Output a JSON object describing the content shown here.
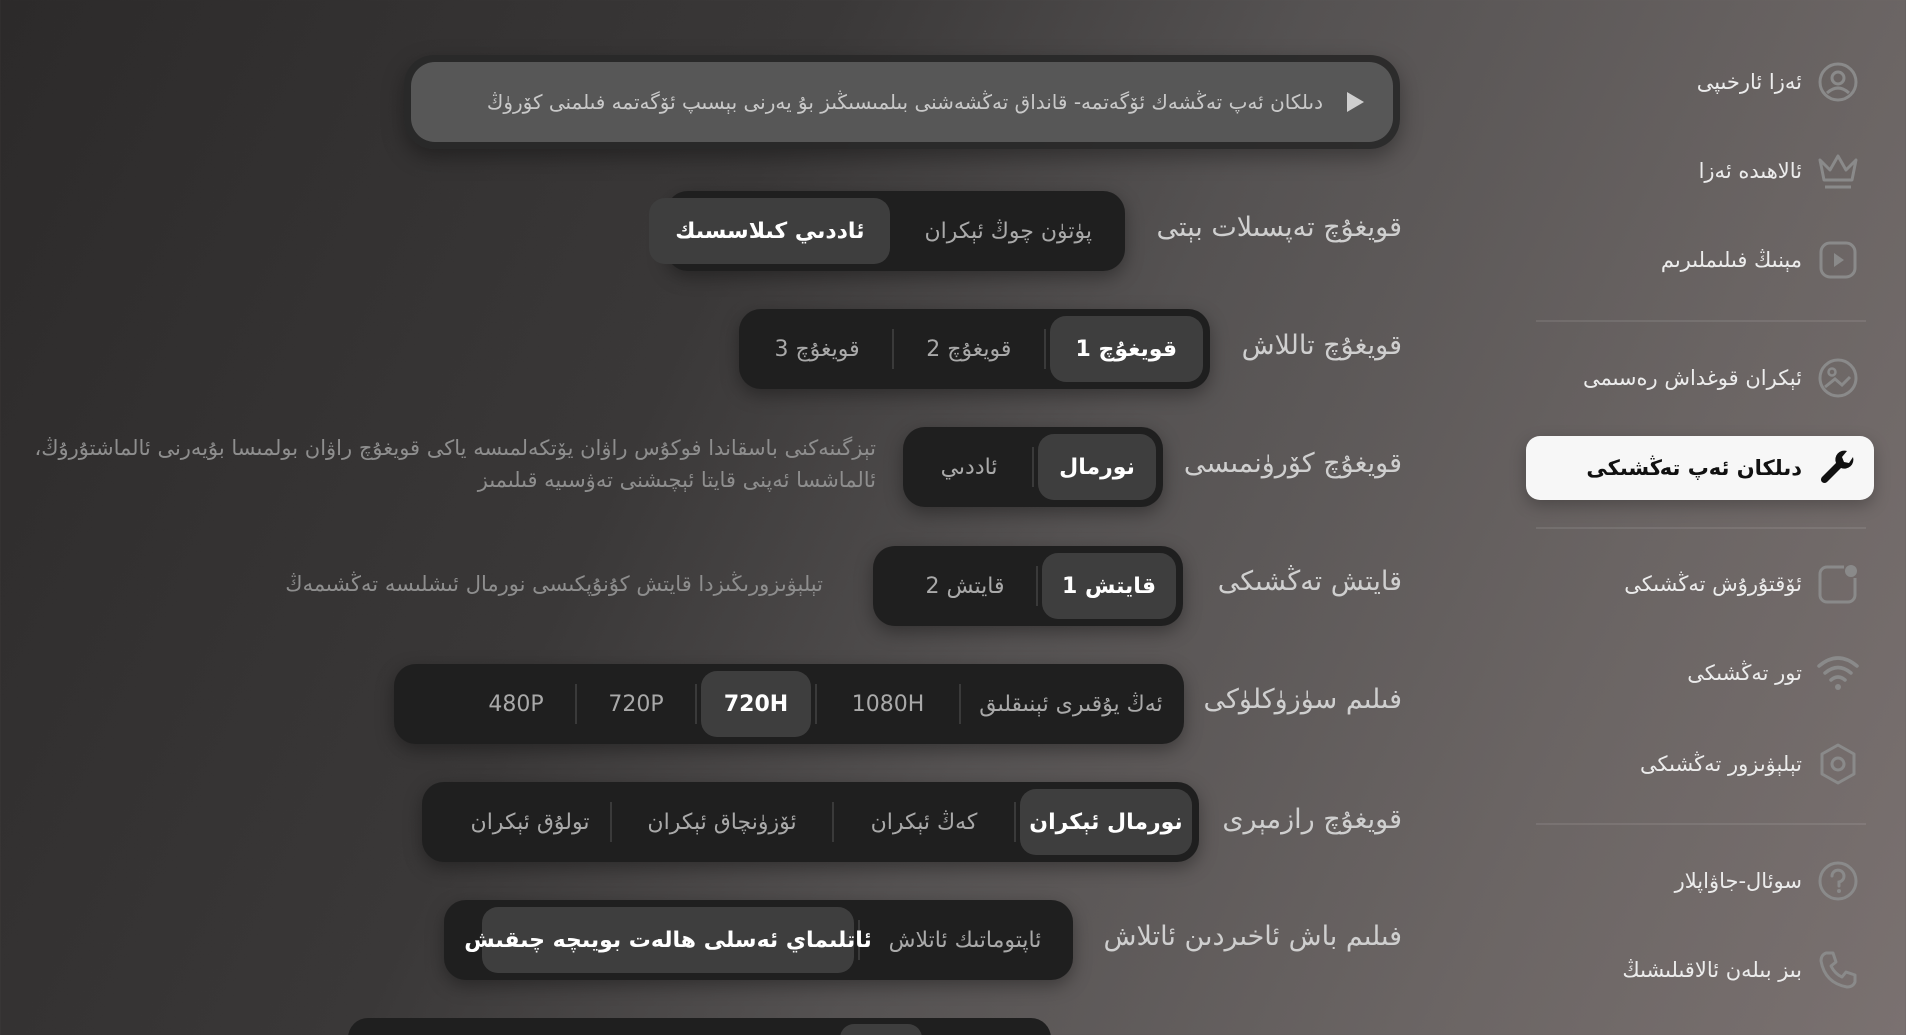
{
  "sidebar": {
    "items": [
      {
        "label": "ئەزا ئارخىپى",
        "icon": "user-circle-icon"
      },
      {
        "label": "ئالاھىدە ئەزا",
        "icon": "crown-icon"
      },
      {
        "label": "مېنىڭ فىلىملىرىم",
        "icon": "play-square-icon"
      },
      {
        "label": "ئېكران قوغداش رەسىمى",
        "icon": "image-icon"
      },
      {
        "label": "دىلكان ئەپ تەڭشىكى",
        "icon": "wrench-icon"
      },
      {
        "label": "ئۆقتۇرۇش تەڭشىكى",
        "icon": "notification-icon"
      },
      {
        "label": "تور تەڭشىكى",
        "icon": "wifi-icon"
      },
      {
        "label": "تېلېۋىزور تەڭشىكى",
        "icon": "settings-icon"
      },
      {
        "label": "سوئال-جاۋاپلار",
        "icon": "question-icon"
      },
      {
        "label": "بىز بىلەن ئالاقىلىشىڭ",
        "icon": "phone-icon"
      }
    ],
    "active_index": 4
  },
  "playbar": {
    "text": "دىلكان ئەپ تەڭشەك ئۆگەتمە- قانداق تەڭشەشنى بىلمىسىڭىز بۇ يەرنى بېسىپ ئۆگەتمە فىلمنى كۆرۈڭ",
    "icon": "play-icon"
  },
  "settings": [
    {
      "label": "قويغۇچ تەپسىلات بېتى",
      "options": [
        "پۈتۈن چوڭ ئېكران",
        "ئاددىي كىلاسسىك"
      ],
      "selected": 1
    },
    {
      "label": "قويغۇچ تاللاش",
      "options": [
        "قويغۇچ 1",
        "قويغۇچ 2",
        "قويغۇچ 3"
      ],
      "selected": 0
    },
    {
      "label": "قويغۇچ كۆرۈنمىسى",
      "options": [
        "نورمال",
        "ئاددىي"
      ],
      "selected": 0,
      "hint_line1": "تېزگىنەكنى باسقاندا فوكۇس راۋان يۆتكەلمىسە ياكى قويغۇچ راۋان بولمىسا بۇيەرنى ئالماشتۇرۇڭ،",
      "hint_line2": "ئالماشسا ئەپنى قايتا ئېچىشنى تەۋسىيە قىلىمىز"
    },
    {
      "label": "قايتش تەڭشىكى",
      "options": [
        "قايتش 1",
        "قايتش 2"
      ],
      "selected": 0,
      "hint_line1": "تېلېۋىزورىڭىزدا قايتش كۇنۇپكىسى نورمال ئىشلىسە تەڭشىمەڭ"
    },
    {
      "label": "فىلىم سۈزۈكلۈكى",
      "options": [
        "ئەڭ يۇقىرى ئېنىقلىق",
        "1080H",
        "720H",
        "720P",
        "480P"
      ],
      "selected": 2
    },
    {
      "label": "قويغۇچ رازمېرى",
      "options": [
        "نورمال ئېكران",
        "كەڭ ئېكران",
        "ئۆزۈنچاق ئېكران",
        "تولۇق ئېكران"
      ],
      "selected": 0
    },
    {
      "label": "فىلىم باش ئاخىردىن ئاتلاش",
      "options": [
        "ئاپتوماتىك ئاتلاش",
        "ئاتلىماي ئەسلى ھالەت بويىچە چىقىش"
      ],
      "selected": 1
    }
  ],
  "colors": {
    "active_bg": "#f7f7f7",
    "segment_bg": "#1f1f1f",
    "selected_option_bg": "#3e3e3e"
  }
}
